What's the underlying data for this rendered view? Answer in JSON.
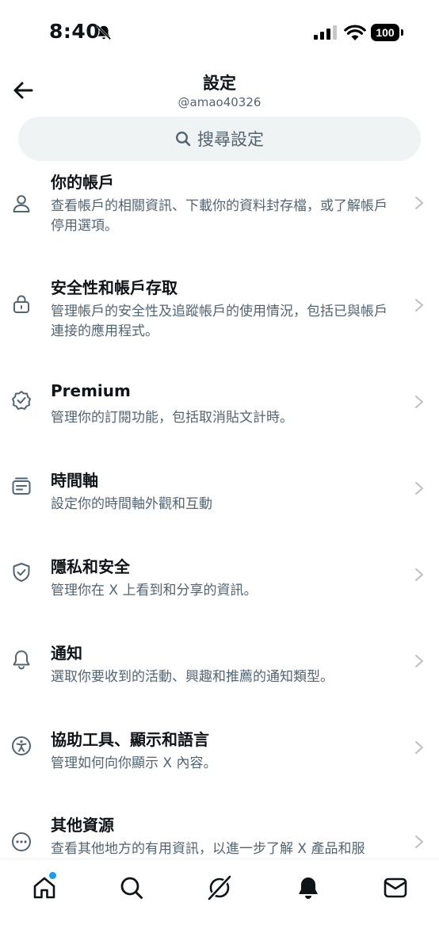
{
  "status_bar": {
    "time": "8:40",
    "battery": "100"
  },
  "header": {
    "title": "設定",
    "subtitle": "@amao40326"
  },
  "search": {
    "placeholder": "搜尋設定"
  },
  "settings": {
    "items": [
      {
        "title": "你的帳戶",
        "desc": "查看帳戶的相關資訊、下載你的資料封存檔，或了解帳戶停用選項。",
        "icon": "person-icon"
      },
      {
        "title": "安全性和帳戶存取",
        "desc": "管理帳戶的安全性及追蹤帳戶的使用情況，包括已與帳戶連接的應用程式。",
        "icon": "lock-icon"
      },
      {
        "title": "Premium",
        "desc": "管理你的訂閱功能，包括取消貼文計時。",
        "icon": "verified-badge-icon"
      },
      {
        "title": "時間軸",
        "desc": "設定你的時間軸外觀和互動",
        "icon": "timeline-icon"
      },
      {
        "title": "隱私和安全",
        "desc": "管理你在 X 上看到和分享的資訊。",
        "icon": "shield-icon"
      },
      {
        "title": "通知",
        "desc": "選取你要收到的活動、興趣和推薦的通知類型。",
        "icon": "bell-icon"
      },
      {
        "title": "協助工具、顯示和語言",
        "desc": "管理如何向你顯示 X 內容。",
        "icon": "accessibility-icon"
      },
      {
        "title": "其他資源",
        "desc": "查看其他地方的有用資訊，以進一步了解 X 產品和服務。",
        "icon": "more-icon"
      }
    ]
  },
  "bottom_nav": {
    "items": [
      "home-icon",
      "search-icon",
      "grok-icon",
      "notifications-icon",
      "messages-icon"
    ],
    "home_has_unread_dot": true
  },
  "colors": {
    "text": "#0f1419",
    "secondary": "#536471",
    "search_bg": "#eff3f4",
    "accent": "#1d9bf0",
    "chevron": "#b9c0c5"
  }
}
